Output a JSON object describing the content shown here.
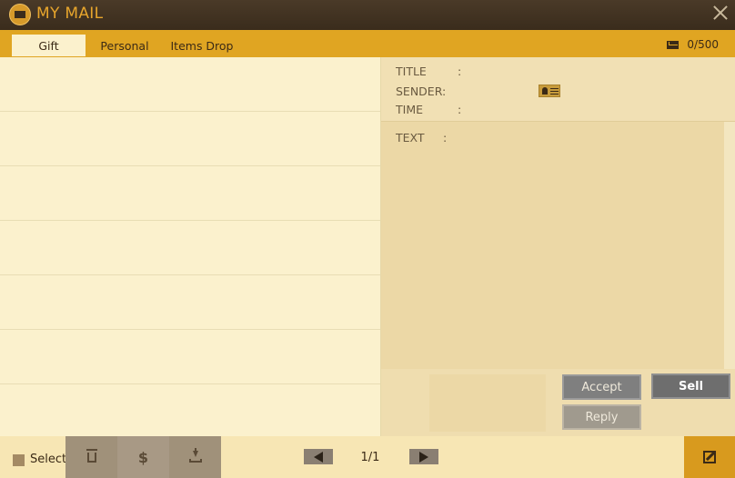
{
  "window": {
    "title": "MY MAIL"
  },
  "tabs": [
    {
      "label": "Gift",
      "active": true
    },
    {
      "label": "Personal",
      "active": false
    },
    {
      "label": "Items Drop",
      "active": false
    }
  ],
  "mailbox": {
    "count": "0/500"
  },
  "mail_list": {
    "rows": 7
  },
  "detail": {
    "title_label": "TITLE",
    "sender_label": "SENDER",
    "time_label": "TIME",
    "text_label": "TEXT",
    "colon": ":"
  },
  "actions": {
    "accept": "Accept",
    "reply": "Reply",
    "sell": "Sell"
  },
  "footer": {
    "select_label": "Select",
    "dollar_symbol": "$",
    "page": "1/1"
  },
  "colors": {
    "accent": "#e0a522",
    "titlebar": "#3a2c1c",
    "panel": "#fbf1cd"
  }
}
